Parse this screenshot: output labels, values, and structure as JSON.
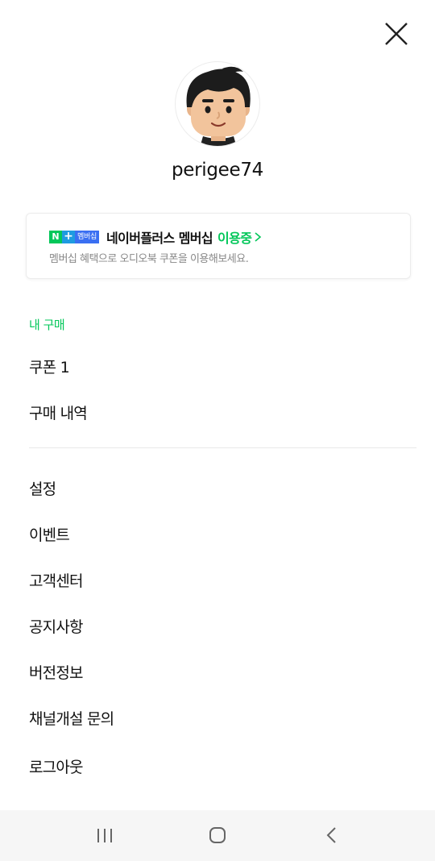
{
  "close": {
    "icon": "close-icon"
  },
  "profile": {
    "username": "perigee74",
    "avatar_icon": "avatar-icon"
  },
  "membership": {
    "badge_n": "N",
    "badge_plus": "+",
    "badge_label": "멤버십",
    "title": "네이버플러스 멤버십",
    "status": "이용중",
    "subtitle": "멤버십 혜택으로 오디오북 쿠폰을 이용해보세요."
  },
  "my_purchase": {
    "title": "내 구매",
    "items": [
      "쿠폰 1",
      "구매 내역"
    ]
  },
  "menu": {
    "items": [
      "설정",
      "이벤트",
      "고객센터",
      "공지사항",
      "버전정보",
      "채널개설 문의",
      "로그아웃"
    ]
  },
  "navbar": {
    "recent_icon": "recent-apps-icon",
    "home_icon": "home-icon",
    "back_icon": "back-icon"
  },
  "colors": {
    "accent": "#03c75a",
    "nav_background": "#f6f6f6"
  }
}
